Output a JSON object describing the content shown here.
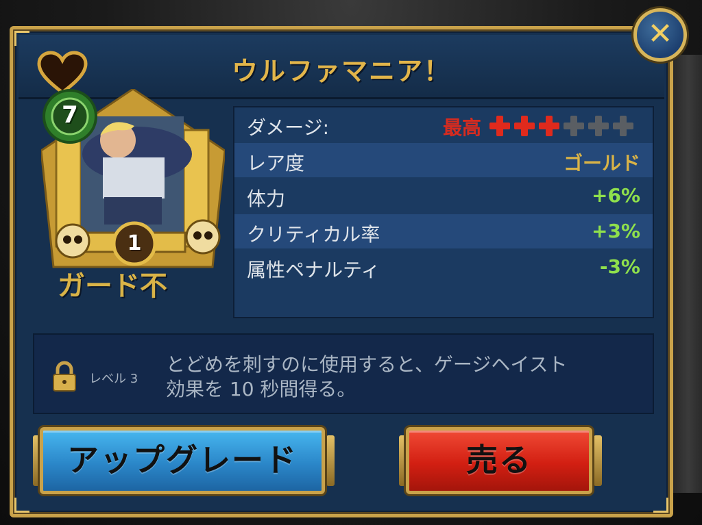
{
  "dialog": {
    "title": "ウルファマニア！",
    "close_label": "✕"
  },
  "card": {
    "level_badge": "7",
    "rank_badge": "1",
    "ability_name": "ガード不"
  },
  "stats": [
    {
      "label": "ダメージ:",
      "value": "最高"
    },
    {
      "label": "レア度",
      "value": "ゴールド"
    },
    {
      "label": "体力",
      "value": "+6%"
    },
    {
      "label": "クリティカル率",
      "value": "+3%"
    },
    {
      "label": "属性ペナルティ",
      "value": "-3%"
    }
  ],
  "damage_rating": {
    "filled": 3,
    "total": 6
  },
  "perk": {
    "level_label": "レベル 3",
    "description_line1": "とどめを刺すのに使用すると、ゲージヘイスト",
    "description_line2": "効果を 10 秒間得る。"
  },
  "buttons": {
    "upgrade": "アップグレード",
    "sell": "売る"
  },
  "colors": {
    "gold": "#d9b347",
    "green": "#8fe04c",
    "red": "#e02a1c",
    "panel": "#16304f"
  },
  "icons": [
    "heart-icon",
    "close-icon",
    "lock-icon",
    "gear-badge-icon",
    "skull-icon"
  ]
}
